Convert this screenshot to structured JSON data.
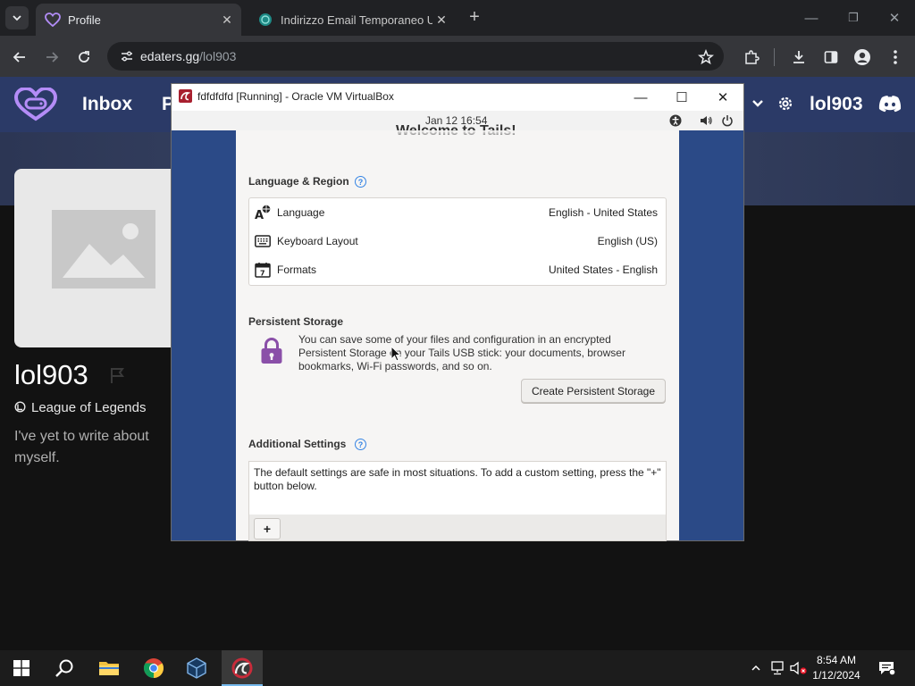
{
  "browser": {
    "tabs": [
      {
        "title": "Profile",
        "active": true
      },
      {
        "title": "Indirizzo Email Temporaneo Usa",
        "active": false
      }
    ],
    "new_tab_label": "+",
    "url_host": "edaters.gg",
    "url_path": "/lol903",
    "window_controls": {
      "minimize": "—",
      "maximize": "❐",
      "close": "✕"
    },
    "toolbar_icons": [
      "back-icon",
      "forward-icon",
      "reload-icon",
      "site-info-icon",
      "bookmark-star-icon",
      "extensions-icon",
      "download-icon",
      "side-panel-icon",
      "profile-icon",
      "menu-icon"
    ]
  },
  "site": {
    "nav": {
      "inbox": "Inbox",
      "partial": "P",
      "username": "lol903"
    },
    "profile": {
      "username": "lol903",
      "game": "League of Legends",
      "bio": "I've yet to write about myself."
    },
    "colors": {
      "navbar": "#2b3a67",
      "accent": "#7c6cf0"
    }
  },
  "vbox": {
    "title": "fdfdfdfd [Running] - Oracle VM VirtualBox",
    "controls": {
      "minimize": "—",
      "maximize": "☐",
      "close": "✕"
    },
    "clock": "Jan 12  16:54"
  },
  "tails": {
    "welcome": "Welcome to Tails!",
    "language_region": {
      "heading": "Language & Region",
      "rows": [
        {
          "label": "Language",
          "value": "English - United States",
          "icon": "language-icon"
        },
        {
          "label": "Keyboard Layout",
          "value": "English (US)",
          "icon": "keyboard-icon"
        },
        {
          "label": "Formats",
          "value": "United States - English",
          "icon": "calendar-icon"
        }
      ]
    },
    "persistent_storage": {
      "heading": "Persistent Storage",
      "description": "You can save some of your files and configuration in an encrypted Persistent Storage on your Tails USB stick: your documents, browser bookmarks, Wi-Fi passwords, and so on.",
      "button": "Create Persistent Storage"
    },
    "additional_settings": {
      "heading": "Additional Settings",
      "description": "The default settings are safe in most situations. To add a custom setting, press the \"+\" button below.",
      "add_button": "+"
    },
    "help_glyph": "?"
  },
  "taskbar": {
    "time": "8:54 AM",
    "date": "1/12/2024",
    "apps": [
      "start-icon",
      "search-icon",
      "file-explorer-icon",
      "chrome-icon",
      "virtualbox-icon",
      "tails-icon"
    ]
  }
}
